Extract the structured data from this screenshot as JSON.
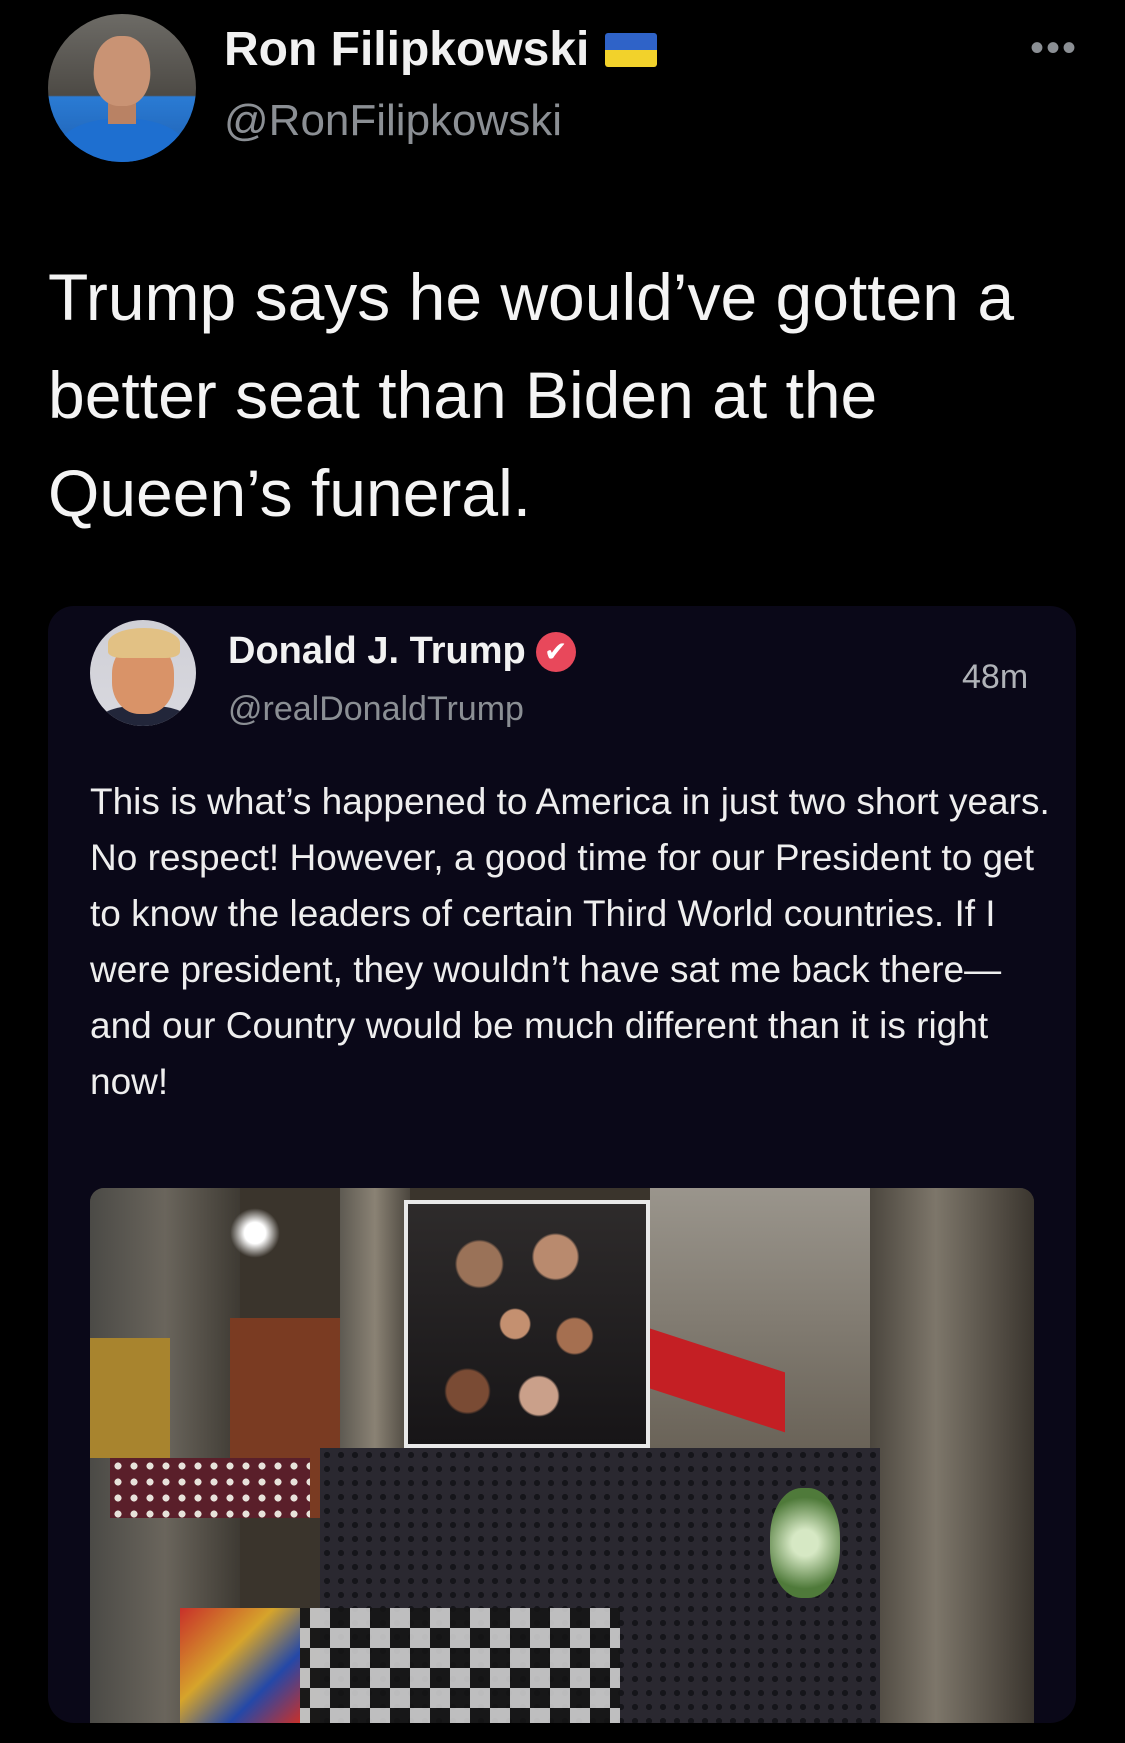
{
  "tweet": {
    "author_name": "Ron Filipkowski",
    "author_handle": "@RonFilipkowski",
    "flag_icon": "ukraine-flag-icon",
    "more_label": "•••",
    "text": "Trump says he would’ve gotten a better seat than Biden at the Queen’s funeral."
  },
  "quoted": {
    "author_name": "Donald J. Trump",
    "author_handle": "@realDonaldTrump",
    "verified_icon": "verified-badge-icon",
    "verified_glyph": "✔",
    "verified_color": "#e8485b",
    "time": "48m",
    "text": "This is what’s happened to America in just two short years. No respect! However, a good time for our President to get to know the leaders of certain Third World countries. If I were president, they wouldn’t have sat me back there—and our Country would be much different than it is right now!"
  }
}
